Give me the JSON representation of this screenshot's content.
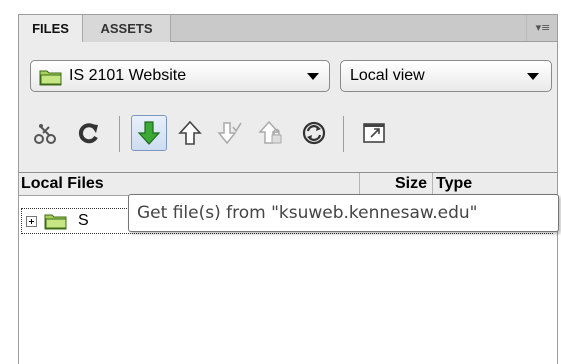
{
  "tabs": [
    {
      "label": "FILES",
      "active": true
    },
    {
      "label": "ASSETS",
      "active": false
    }
  ],
  "site_select": {
    "value": "IS 2101 Website",
    "icon": "folder-icon"
  },
  "view_select": {
    "value": "Local view"
  },
  "toolbar": {
    "tools": [
      {
        "name": "connect-icon"
      },
      {
        "name": "refresh-icon"
      },
      {
        "name": "get-files-icon",
        "active": true
      },
      {
        "name": "put-files-icon"
      },
      {
        "name": "check-out-icon"
      },
      {
        "name": "check-in-icon"
      },
      {
        "name": "synchronize-icon"
      },
      {
        "name": "expand-icon"
      }
    ]
  },
  "file_list": {
    "columns": {
      "name": "Local Files",
      "size": "Size",
      "type": "Type"
    },
    "rows": [
      {
        "name": "S",
        "icon": "folder-icon"
      }
    ]
  },
  "tooltip": {
    "text": "Get file(s) from \"ksuweb.kennesaw.edu\""
  },
  "colors": {
    "panel": "#ececec",
    "folder": "#a5d05a",
    "get_arrow": "#3aa935",
    "tooltip_border": "#767676"
  }
}
